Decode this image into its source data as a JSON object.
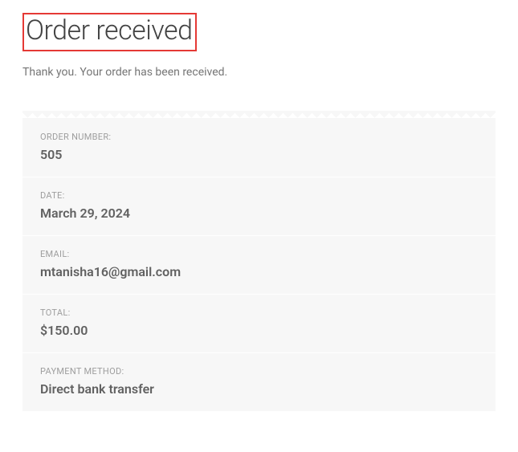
{
  "page": {
    "title": "Order received",
    "thankyou": "Thank you. Your order has been received."
  },
  "order": {
    "number_label": "ORDER NUMBER:",
    "number_value": "505",
    "date_label": "DATE:",
    "date_value": "March 29, 2024",
    "email_label": "EMAIL:",
    "email_value": "mtanisha16@gmail.com",
    "total_label": "TOTAL:",
    "total_value": "$150.00",
    "payment_label": "PAYMENT METHOD:",
    "payment_value": "Direct bank transfer"
  }
}
